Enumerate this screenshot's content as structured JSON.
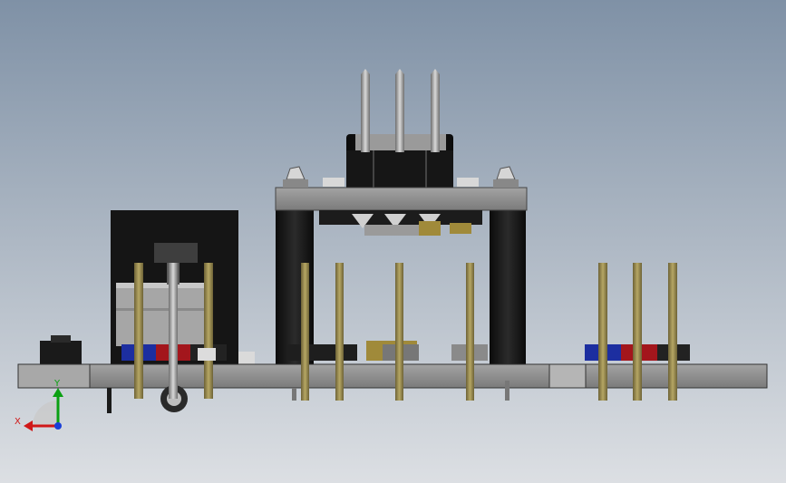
{
  "view": {
    "title": "",
    "background_top": "#7f91a6",
    "background_bottom": "#dcdfe3"
  },
  "triad": {
    "x_label": "X",
    "y_label": "Y",
    "x_color": "#d01818",
    "y_color": "#0aa012",
    "z_color": "#1a3fd8"
  },
  "colors": {
    "board": "#8c8c8c",
    "black_part": "#141414",
    "header_blue": "#1c2ea0",
    "header_red": "#a3161c",
    "brass_pin": "#9a8b4a",
    "steel_pin": "#b9b9b9"
  },
  "icons": [
    "axis-triad-icon"
  ]
}
